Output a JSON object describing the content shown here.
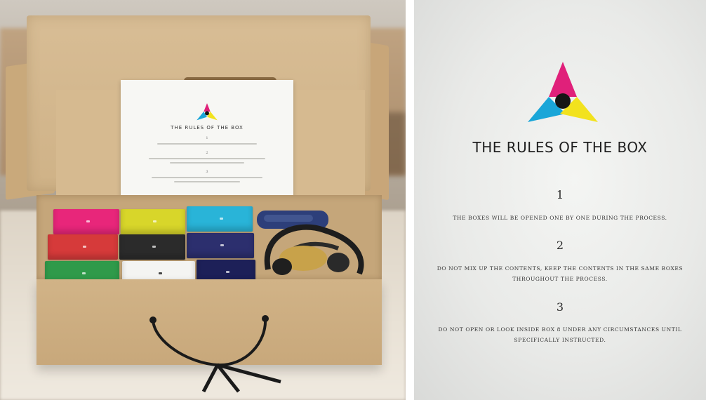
{
  "poster": {
    "title": "THE RULES OF THE BOX",
    "rules": [
      {
        "number": "1",
        "text": "THE BOXES WILL BE OPENED ONE BY ONE DURING THE PROCESS."
      },
      {
        "number": "2",
        "text": "DO NOT MIX UP THE CONTENTS, KEEP THE CONTENTS IN THE SAME BOXES THROUGHOUT THE PROCESS."
      },
      {
        "number": "3",
        "text": "DO NOT OPEN OR LOOK INSIDE BOX 8 UNDER ANY CIRCUMSTANCES UNTIL SPECIFICALLY INSTRUCTED."
      }
    ]
  },
  "logo_colors": {
    "magenta": "#e0207a",
    "cyan": "#1aa6d8",
    "yellow": "#f2e21e",
    "center": "#151515"
  },
  "mini_boxes": [
    {
      "color": "#e8267a"
    },
    {
      "color": "#d8d62a"
    },
    {
      "color": "#29b4d8"
    },
    {
      "color": "#d63a3a"
    },
    {
      "color": "#2b2b2b"
    },
    {
      "color": "#2c2f6e"
    },
    {
      "color": "#2f9a4a"
    },
    {
      "color": "#f4f4f2"
    },
    {
      "color": "#1d2058"
    }
  ]
}
